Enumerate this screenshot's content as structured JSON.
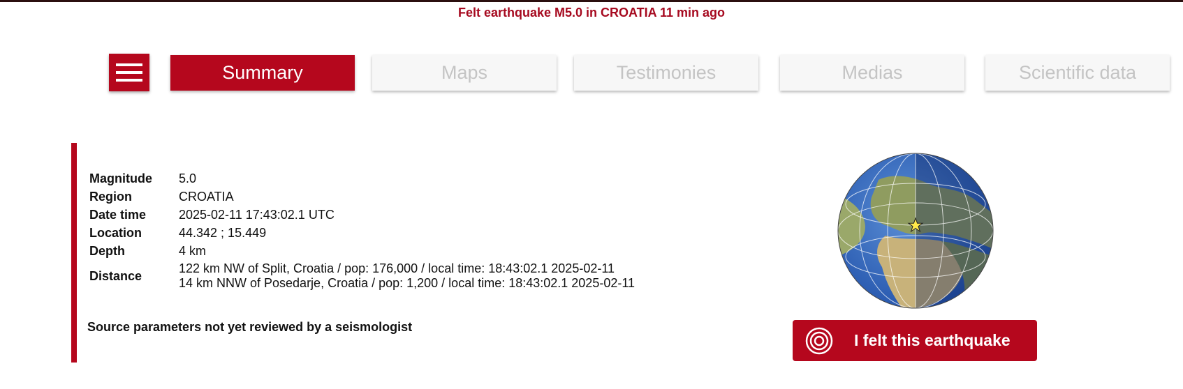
{
  "headline": "Felt earthquake M5.0 in CROATIA 11 min ago",
  "nav": {
    "menu_icon": "hamburger-icon",
    "tabs": [
      {
        "label": "Summary",
        "active": true
      },
      {
        "label": "Maps",
        "active": false
      },
      {
        "label": "Testimonies",
        "active": false
      },
      {
        "label": "Medias",
        "active": false
      },
      {
        "label": "Scientific data",
        "active": false
      }
    ]
  },
  "summary": {
    "magnitude": {
      "label": "Magnitude",
      "value": "5.0"
    },
    "region": {
      "label": "Region",
      "value": "CROATIA"
    },
    "datetime": {
      "label": "Date time",
      "value": "2025-02-11 17:43:02.1 UTC"
    },
    "location": {
      "label": "Location",
      "value": "44.342 ; 15.449"
    },
    "depth": {
      "label": "Depth",
      "value": "4 km"
    },
    "distance": {
      "label": "Distance",
      "lines": [
        "122 km NW of Split, Croatia / pop: 176,000 / local time: 18:43:02.1 2025-02-11",
        "14 km NNW of Posedarje, Croatia / pop: 1,200 / local time: 18:43:02.1 2025-02-11"
      ]
    },
    "review_note": "Source parameters not yet reviewed by a seismologist"
  },
  "felt_button": {
    "label": "I felt this earthquake",
    "icon": "seismic-rings-icon"
  },
  "globe": {
    "marker_icon": "epicenter-star-icon"
  },
  "colors": {
    "accent": "#b5071d",
    "headline": "#a6091f",
    "tab_inactive_bg": "#f7f7f7",
    "tab_inactive_text": "#c4c4c4"
  }
}
